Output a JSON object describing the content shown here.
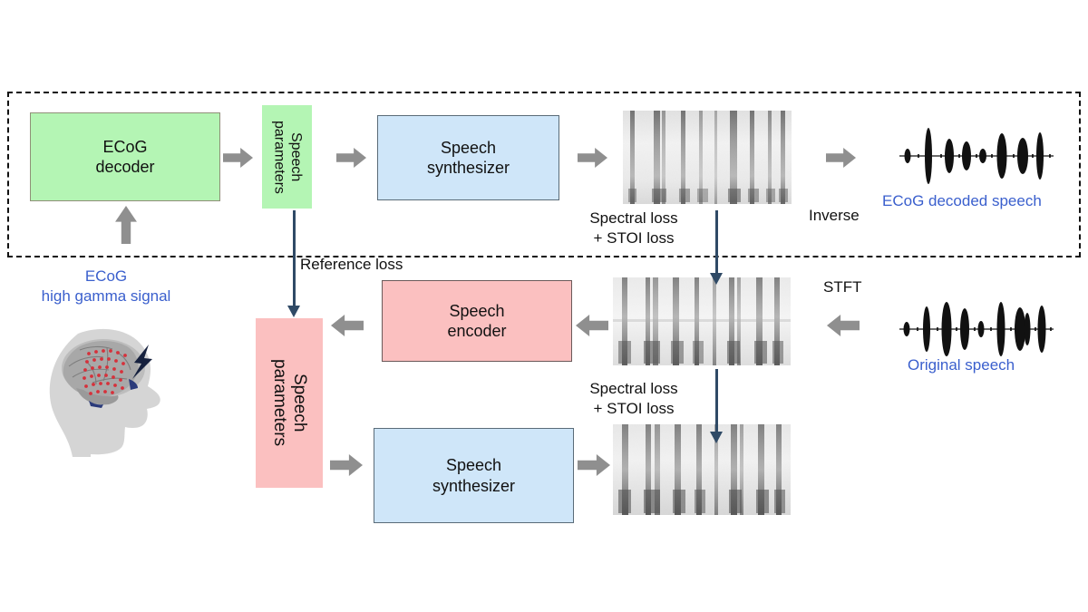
{
  "figure": {
    "title": "ECoG-to-speech decoding and speech auto-encoder training pipeline",
    "colors": {
      "decoder_box": "#b4f5b4",
      "synthesizer_box": "#cfe6f9",
      "encoder_box": "#fbc0c0",
      "gray_arrow": "#8f8f8f",
      "navy_arrow": "#2f4a66",
      "blue_text": "#3a5fcd",
      "dashed_border": "#111111",
      "background": "#ffffff"
    }
  },
  "decoding_branch": {
    "enclosure_label": "decoding-pipeline-dashed-region",
    "ecog_decoder": "ECoG\ndecoder",
    "speech_parameters": "Speech\nparameters",
    "speech_synthesizer": "Speech\nsynthesizer",
    "decoded_spectrogram": "decoded-speech-spectrogram",
    "inverse_label": "Inverse",
    "decoded_speech_label": "ECoG decoded speech",
    "decoded_waveform": "ecog-decoded-speech-waveform"
  },
  "input": {
    "ecog_signal_label": "ECoG\nhigh gamma signal",
    "brain_image": "head-with-ecog-grid-on-brain"
  },
  "autoencoder_branch": {
    "speech_encoder": "Speech\nencoder",
    "speech_parameters": "Speech\nparameters",
    "speech_synthesizer": "Speech\nsynthesizer",
    "original_spectrogram": "original-speech-spectrogram",
    "resynthesized_spectrogram": "resynthesized-speech-spectrogram",
    "stft_label": "STFT",
    "original_speech_label": "Original speech",
    "original_waveform": "original-speech-waveform"
  },
  "losses": {
    "reference_loss": "Reference loss",
    "spectral_stoi_top": "Spectral loss\n+ STOI loss",
    "spectral_stoi_bottom": "Spectral loss\n+ STOI loss"
  },
  "chart_data": {
    "type": "diagram",
    "nodes": [
      {
        "id": "ecog_decoder",
        "label": "ECoG decoder",
        "color": "#b4f5b4"
      },
      {
        "id": "speech_params_top",
        "label": "Speech parameters",
        "color": "#b4f5b4"
      },
      {
        "id": "speech_synth_top",
        "label": "Speech synthesizer",
        "color": "#cfe6f9"
      },
      {
        "id": "spec_decoded",
        "label": "decoded spectrogram",
        "color": "#ffffff"
      },
      {
        "id": "wave_decoded",
        "label": "ECoG decoded speech",
        "color": "#ffffff"
      },
      {
        "id": "speech_encoder",
        "label": "Speech encoder",
        "color": "#fbc0c0"
      },
      {
        "id": "speech_params_bottom",
        "label": "Speech parameters",
        "color": "#fbc0c0"
      },
      {
        "id": "speech_synth_bottom",
        "label": "Speech synthesizer",
        "color": "#cfe6f9"
      },
      {
        "id": "spec_original",
        "label": "original spectrogram",
        "color": "#ffffff"
      },
      {
        "id": "spec_resynth",
        "label": "resynthesized spectrogram",
        "color": "#ffffff"
      },
      {
        "id": "wave_original",
        "label": "Original speech",
        "color": "#ffffff"
      }
    ],
    "edges": [
      {
        "from": "brain",
        "to": "ecog_decoder",
        "label": "",
        "style": "gray-block-up"
      },
      {
        "from": "ecog_decoder",
        "to": "speech_params_top",
        "label": "",
        "style": "gray-block-right"
      },
      {
        "from": "speech_params_top",
        "to": "speech_synth_top",
        "label": "",
        "style": "gray-block-right"
      },
      {
        "from": "speech_synth_top",
        "to": "spec_decoded",
        "label": "",
        "style": "gray-block-right"
      },
      {
        "from": "spec_decoded",
        "to": "wave_decoded",
        "label": "Inverse",
        "style": "gray-block-right"
      },
      {
        "from": "speech_params_bottom",
        "to": "speech_params_top",
        "label": "Reference loss",
        "style": "navy-down"
      },
      {
        "from": "spec_original",
        "to": "spec_decoded",
        "label": "Spectral loss + STOI loss",
        "style": "navy-down"
      },
      {
        "from": "spec_resynth",
        "to": "spec_original",
        "label": "Spectral loss + STOI loss",
        "style": "navy-down"
      },
      {
        "from": "wave_original",
        "to": "spec_original",
        "label": "STFT",
        "style": "gray-block-left"
      },
      {
        "from": "spec_original",
        "to": "speech_encoder",
        "label": "",
        "style": "gray-block-left"
      },
      {
        "from": "speech_encoder",
        "to": "speech_params_bottom",
        "label": "",
        "style": "gray-block-left"
      },
      {
        "from": "speech_params_bottom",
        "to": "speech_synth_bottom",
        "label": "",
        "style": "gray-block-right"
      },
      {
        "from": "speech_synth_bottom",
        "to": "spec_resynth",
        "label": "",
        "style": "gray-block-right"
      }
    ]
  }
}
